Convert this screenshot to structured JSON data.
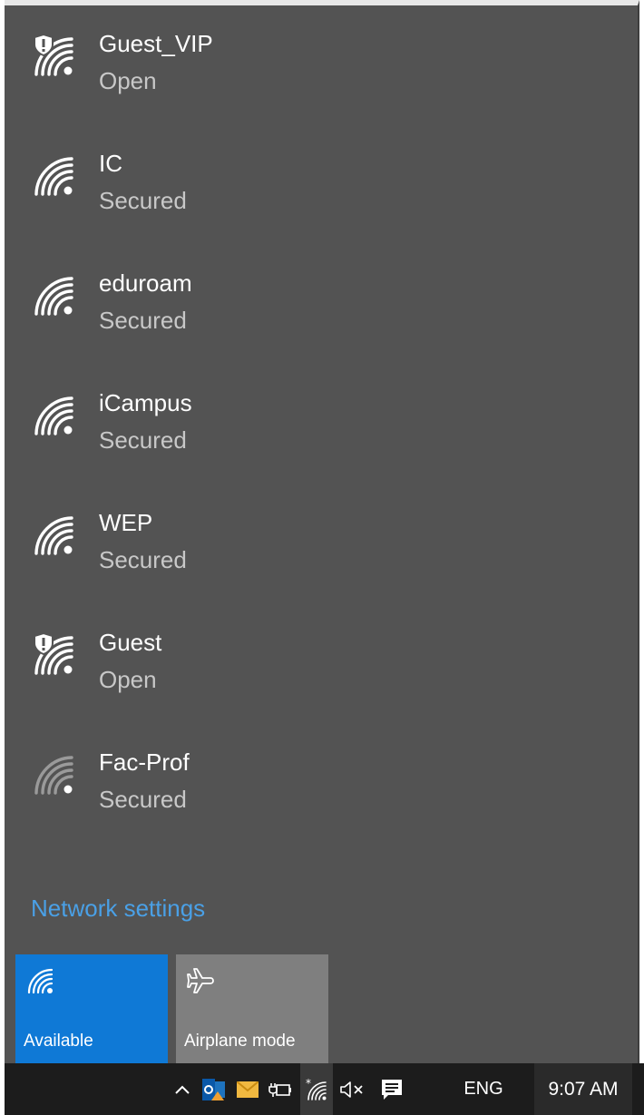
{
  "networks": [
    {
      "name": "Guest_VIP",
      "status": "Open",
      "icon": "wifi-open-icon"
    },
    {
      "name": "IC",
      "status": "Secured",
      "icon": "wifi-icon"
    },
    {
      "name": "eduroam",
      "status": "Secured",
      "icon": "wifi-icon"
    },
    {
      "name": "iCampus",
      "status": "Secured",
      "icon": "wifi-icon"
    },
    {
      "name": "WEP",
      "status": "Secured",
      "icon": "wifi-icon"
    },
    {
      "name": "Guest",
      "status": "Open",
      "icon": "wifi-open-icon"
    },
    {
      "name": "Fac-Prof",
      "status": "Secured",
      "icon": "wifi-weak-icon"
    }
  ],
  "network_settings_label": "Network settings",
  "quick_actions": {
    "wifi": {
      "label": "Available",
      "icon": "wifi-icon"
    },
    "airplane": {
      "label": "Airplane mode",
      "icon": "airplane-icon"
    }
  },
  "taskbar": {
    "language": "ENG",
    "time": "9:07 AM",
    "icons": [
      "chevron-up-icon",
      "outlook-icon",
      "mail-icon",
      "power-plug-icon",
      "wifi-icon",
      "volume-muted-icon",
      "action-center-icon"
    ]
  },
  "colors": {
    "flyout_bg": "#535353",
    "accent": "#0f79d6",
    "link": "#4aa0e6",
    "taskbar_bg": "#1c1c1c"
  }
}
